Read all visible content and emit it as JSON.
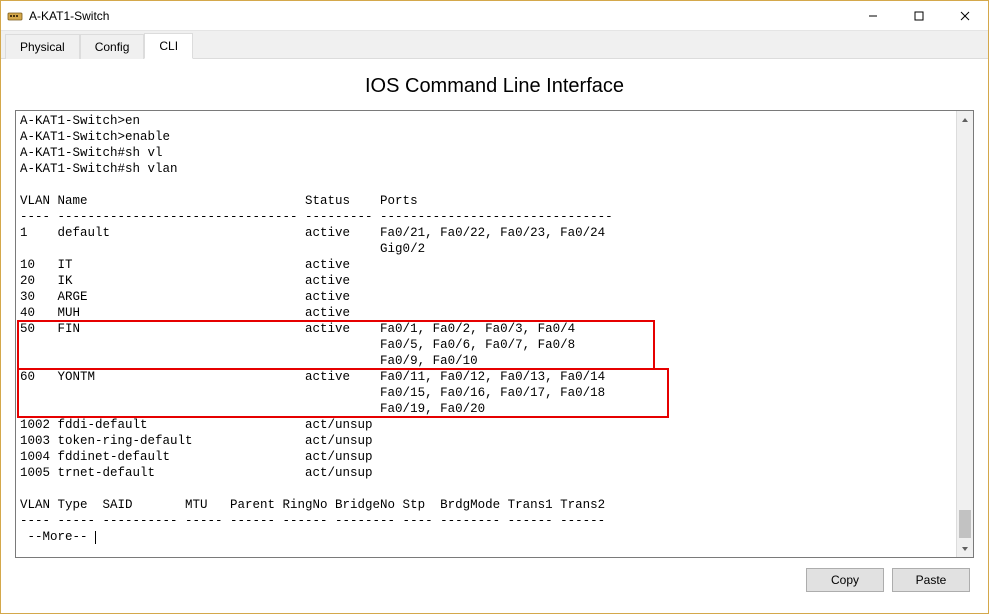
{
  "window": {
    "title": "A-KAT1-Switch"
  },
  "tabs": {
    "physical": "Physical",
    "config": "Config",
    "cli": "CLI"
  },
  "cli_heading": "IOS Command Line Interface",
  "terminal_lines": {
    "l0": "A-KAT1-Switch>en",
    "l1": "A-KAT1-Switch>enable",
    "l2": "A-KAT1-Switch#sh vl",
    "l3": "A-KAT1-Switch#sh vlan",
    "l4": "",
    "l5": "VLAN Name                             Status    Ports",
    "l6": "---- -------------------------------- --------- -------------------------------",
    "l7": "1    default                          active    Fa0/21, Fa0/22, Fa0/23, Fa0/24",
    "l8": "                                                Gig0/2",
    "l9": "10   IT                               active    ",
    "l10": "20   IK                               active    ",
    "l11": "30   ARGE                             active    ",
    "l12": "40   MUH                              active    ",
    "l13": "50   FIN                              active    Fa0/1, Fa0/2, Fa0/3, Fa0/4",
    "l14": "                                                Fa0/5, Fa0/6, Fa0/7, Fa0/8",
    "l15": "                                                Fa0/9, Fa0/10",
    "l16": "60   YONTM                            active    Fa0/11, Fa0/12, Fa0/13, Fa0/14",
    "l17": "                                                Fa0/15, Fa0/16, Fa0/17, Fa0/18",
    "l18": "                                                Fa0/19, Fa0/20",
    "l19": "1002 fddi-default                     act/unsup ",
    "l20": "1003 token-ring-default               act/unsup ",
    "l21": "1004 fddinet-default                  act/unsup ",
    "l22": "1005 trnet-default                    act/unsup ",
    "l23": "",
    "l24": "VLAN Type  SAID       MTU   Parent RingNo BridgeNo Stp  BrdgMode Trans1 Trans2",
    "l25": "---- ----- ---------- ----- ------ ------ -------- ---- -------- ------ ------",
    "l26": " --More-- "
  },
  "buttons": {
    "copy": "Copy",
    "paste": "Paste"
  },
  "highlight_color": "#e60000"
}
